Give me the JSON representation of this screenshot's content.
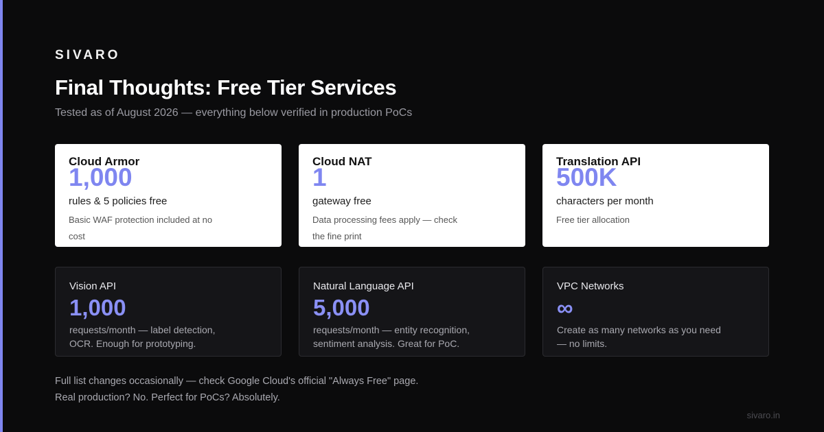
{
  "brand": "SIVARO",
  "title": "Final Thoughts: Free Tier Services",
  "subtitle": "Tested as of August 2026 — everything below verified in production PoCs",
  "highlight_cards": [
    {
      "title": "Cloud Armor",
      "value": "1,000",
      "desc": "rules & 5 policies free",
      "note": "Basic WAF protection included at no cost"
    },
    {
      "title": "Cloud NAT",
      "value": "1",
      "desc": "gateway free",
      "note": "Data processing fees apply — check the fine print"
    },
    {
      "title": "Translation API",
      "value": "500K",
      "desc": "characters per month",
      "note": "Free tier allocation"
    }
  ],
  "cards": [
    {
      "title": "Vision API",
      "value": "1,000",
      "desc": "requests/month — label detection, OCR. Enough for prototyping."
    },
    {
      "title": "Natural Language API",
      "value": "5,000",
      "desc": "requests/month — entity recognition, sentiment analysis. Great for PoC."
    },
    {
      "title": "VPC Networks",
      "value": "∞",
      "desc": "Create as many networks as you need — no limits."
    }
  ],
  "footer": {
    "line1": "Full list changes occasionally — check Google Cloud's official \"Always Free\" page.",
    "line2": "Real production? No. Perfect for PoCs? Absolutely."
  },
  "site": "sivaro.in",
  "colors": {
    "accent": "#7f86f0",
    "background": "#0b0b0c"
  }
}
